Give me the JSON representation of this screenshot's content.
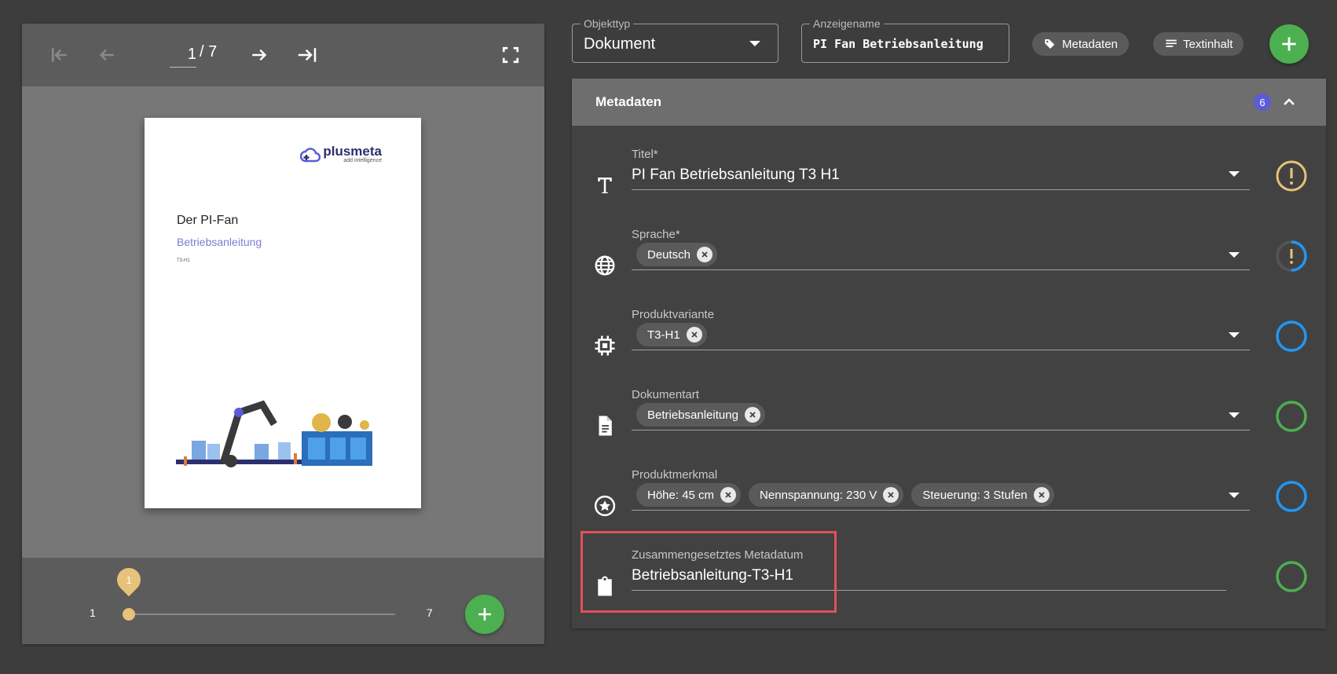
{
  "viewer": {
    "current_page": "1",
    "page_total": "/ 7",
    "slider_min": "1",
    "slider_max": "7",
    "slider_value_label": "1",
    "slider_fraction": 0.0,
    "document": {
      "logo_text": "plusmeta",
      "logo_sub": "add intelligence",
      "title": "Der PI-Fan",
      "subtitle": "Betriebsanleitung",
      "small": "T3-H1"
    }
  },
  "top": {
    "objekttyp_label": "Objekttyp",
    "objekttyp_value": "Dokument",
    "anzeigename_label": "Anzeigename",
    "anzeigename_value": "PI Fan Betriebsanleitung",
    "metadaten_button": "Metadaten",
    "textinhalt_button": "Textinhalt"
  },
  "panel": {
    "title": "Metadaten",
    "badge": "6",
    "fields": [
      {
        "label": "Titel*",
        "value": "PI Fan Betriebsanleitung T3 H1",
        "icon": "text-icon",
        "status": "warning"
      },
      {
        "label": "Sprache*",
        "chips": [
          "Deutsch"
        ],
        "icon": "globe-icon",
        "status": "progress"
      },
      {
        "label": "Produktvariante",
        "chips": [
          "T3-H1"
        ],
        "icon": "chip-icon",
        "status": "blue-ring"
      },
      {
        "label": "Dokumentart",
        "chips": [
          "Betriebsanleitung"
        ],
        "icon": "document-icon",
        "status": "green-ring"
      },
      {
        "label": "Produktmerkmal",
        "chips": [
          "Höhe: 45 cm",
          "Nennspannung: 230 V",
          "Steuerung: 3 Stufen"
        ],
        "icon": "star-icon",
        "status": "blue-ring"
      },
      {
        "label": "Zusammengesetztes Metadatum",
        "value": "Betriebsanleitung-T3-H1",
        "icon": "clipboard-icon",
        "status": "green-ring"
      }
    ]
  },
  "colors": {
    "green": "#4caf50",
    "blue": "#2196f3",
    "gold": "#e6c27a",
    "badge": "#5b5bd6",
    "highlight": "#e5505a"
  }
}
